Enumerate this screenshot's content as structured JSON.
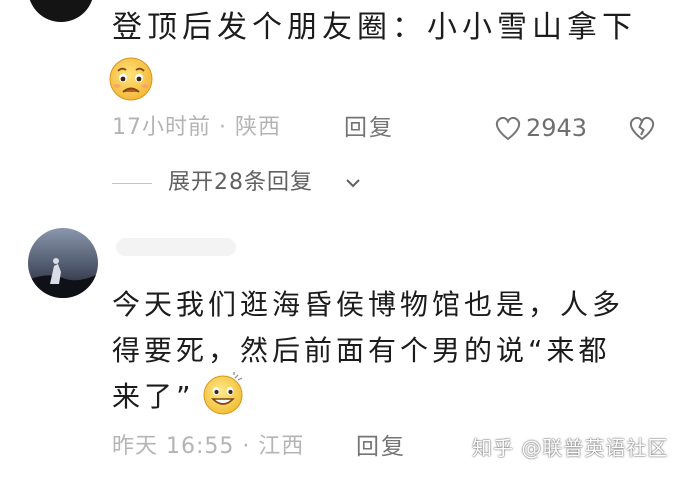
{
  "comments": [
    {
      "text": "登顶后发个朋友圈：小小雪山拿下",
      "emoji": "fearful-face-emoji",
      "time_location": "17小时前 · 陕西",
      "reply_label": "回复",
      "likes": "2943",
      "expand_label": "展开28条回复"
    },
    {
      "lines": [
        "今天我们逛海昏侯博物馆也是，人多",
        "得要死，然后前面有个男的说“来都",
        "来了”"
      ],
      "emoji": "grinning-face-emoji",
      "time_location": "昨天 16:55 · 江西",
      "reply_label": "回复"
    }
  ],
  "watermark": "知乎 @联普英语社区",
  "colors": {
    "text": "#1c1c1c",
    "meta": "#b4b4b4",
    "action": "#757575",
    "emoji_yellow": "#f7c84a"
  }
}
